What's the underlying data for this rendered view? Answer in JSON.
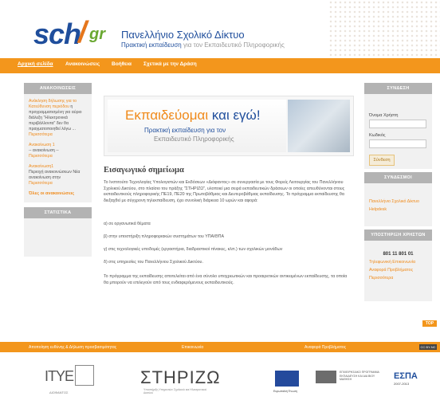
{
  "header": {
    "logo_main": "sch",
    "logo_tld": "gr",
    "title": "Πανελλήνιο Σχολικό Δίκτυο",
    "subtitle_bold": "Πρακτική εκπαίδευση",
    "subtitle_rest": "για τον Εκπαιδευτικό Πληροφορικής"
  },
  "nav": {
    "items": [
      "Αρχική σελίδα",
      "Ανακοινώσεις",
      "Βοήθεια",
      "Σχετικά με την Δράση"
    ]
  },
  "left": {
    "announcements_title": "ΑΝΑΚΟΙΝΩΣΕΙΣ",
    "announcements": [
      {
        "title": "Ανάκληση δήλωσης για το Κατεύθυνση περιόδου",
        "body": "η προγραμματισμένη για αύριο διάλεξη \"Ηλεκτρονικά περιβάλλοντα\" δεν θα πραγματοποιηθεί λόγω ...",
        "more": "Περισσότερα"
      },
      {
        "title": "Ανακοίνωση 1",
        "body": "-- ανακοίνωση --",
        "more": "Περισσότερα"
      },
      {
        "title": "Ανακοίνωση1",
        "body": "Περιοχή ανακοινώσεων Νέα ανακοίνωση στην",
        "more": "Περισσότερα"
      }
    ],
    "all_label": "Όλες οι ανακοινώσεις",
    "stats_title": "ΣΤΑΤΙΣΤΙΚΑ"
  },
  "right": {
    "login_title": "ΣΥΝΔΕΣΗ",
    "username_label": "Όνομα Χρήστη",
    "password_label": "Κωδικός",
    "login_button": "Σύνδεση",
    "links_title": "ΣΥΝΔΕΣΜΟΙ",
    "links": [
      "Πανελλήνιο Σχολικό Δίκτυο",
      "Helpdesk"
    ],
    "support_title": "ΥΠΟΣΤΗΡΙΞΗ ΧΡΗΣΤΩΝ",
    "phone": "801 11 801 01",
    "support_links": [
      "Τηλεφωνική Επικοινωνία",
      "Αναφορά Προβλήματος",
      "Περισσότερα"
    ]
  },
  "main": {
    "banner_line1_a": "Εκπαιδεύομαι",
    "banner_line1_b": "και εγώ!",
    "banner_line2": "Πρακτική εκπαίδευση για τον",
    "banner_line3": "Εκπαιδευτικό Πληροφορικής",
    "intro_title": "Εισαγωγικό σημείωμα",
    "p1": "Το Ινστιτούτο Τεχνολογίας Υπολογιστών και Εκδόσεων «Διόφαντος» σε συνεργασία με τους Φορείς Λειτουργίας του Πανελλήνιου Σχολικού Δικτύου, στο πλαίσιο του πράξης \"ΣΤΗΡΙΖΩ\", υλοποιεί μια σειρά εκπαιδευτικών δράσεων οι οποίες απευθύνονται στους εκπαιδευτικούς πληροφορικής ΠΕ19, ΠΕ20 της Πρωτοβάθμιας και Δευτεροβάθμιας εκπαίδευσης. Το πρόγραμμα εκπαίδευσης θα διεξαχθεί με σύγχρονη τηλεκπαίδευση, έχει συνολική διάρκεια 10 ωρών και αφορά:",
    "p2": "α) σε οργανωτικά θέματα",
    "p3": "β) στην υποστήριξη πληροφοριακών συστημάτων του ΥΠΑΙΘΠΑ",
    "p4": "γ) στις τεχνολογικές υποδομές (εργαστήρια, διαδραστικοί πίνακες, κλπ.) των σχολικών μονάδων",
    "p5": "δ) στις υπηρεσίες του Πανελλήνιου Σχολικού Δικτύου.",
    "p6": "Το πρόγραμμα της εκπαίδευσης αποτελείται από ένα σύνολο υποχρεωτικών και προαιρετικών αντικειμένων εκπαίδευσης, τα οποία θα μπορούν να επιλεγούν από τους ενδιαφερόμενους εκπαιδευτικούς."
  },
  "top_label": "TOP",
  "footer": {
    "links": [
      "Αποποίηση ευθύνης & Δήλωση προσβασιμότητας",
      "Επικοινωνία",
      "Αναφορά Προβλήματος"
    ],
    "cc": "CC BY-NC",
    "ite": "ΙΤΥΕ",
    "ite_sub": "ΔΙΟΦΑΝΤΟΣ",
    "stirizo": "ΣΤΗΡΙΖΩ",
    "stirizo_sub": "Υποστήριξη Υπηρεσιών Σχολικού και Ηλεκτρονικού Δικτύου",
    "eu_caption": "Ευρωπαϊκή Ένωση",
    "epis": "ΕΠΙΧΕΙΡΗΣΙΑΚΟ ΠΡΟΓΡΑΜΜΑ ΕΚΠΑΙΔΕΥΣΗ ΚΑΙ ΔΙΑ ΒΙΟΥ ΜΑΘΗΣΗ",
    "espa": "ΕΣΠΑ",
    "espa_sub": "2007-2013"
  }
}
